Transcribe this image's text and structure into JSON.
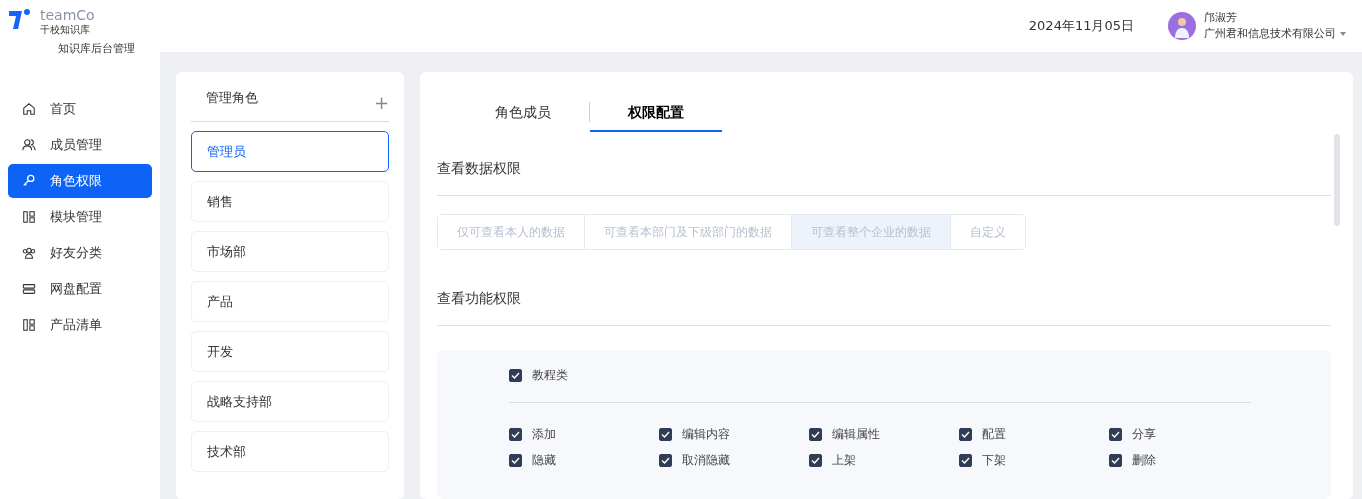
{
  "brand": {
    "name": "teamCo",
    "subtitle": "千校知识库",
    "app_title": "知识库后台管理"
  },
  "header": {
    "date": "2024年11月05日",
    "user_name": "邝淑芳",
    "company": "广州君和信息技术有限公司"
  },
  "sidebar": {
    "items": [
      {
        "label": "首页",
        "kind": "home",
        "selected": false
      },
      {
        "label": "成员管理",
        "kind": "users",
        "selected": false
      },
      {
        "label": "角色权限",
        "kind": "key",
        "selected": true
      },
      {
        "label": "模块管理",
        "kind": "layout",
        "selected": false
      },
      {
        "label": "好友分类",
        "kind": "group",
        "selected": false
      },
      {
        "label": "网盘配置",
        "kind": "storage",
        "selected": false
      },
      {
        "label": "产品清单",
        "kind": "layout",
        "selected": false
      }
    ]
  },
  "roles": {
    "title": "管理角色",
    "add_icon": "+",
    "items": [
      {
        "label": "管理员",
        "selected": true
      },
      {
        "label": "销售",
        "selected": false
      },
      {
        "label": "市场部",
        "selected": false
      },
      {
        "label": "产品",
        "selected": false
      },
      {
        "label": "开发",
        "selected": false
      },
      {
        "label": "战略支持部",
        "selected": false
      },
      {
        "label": "技术部",
        "selected": false
      }
    ]
  },
  "tabs": [
    {
      "label": "角色成员",
      "selected": false
    },
    {
      "label": "权限配置",
      "selected": true
    }
  ],
  "data_permission": {
    "title": "查看数据权限",
    "disabled": true,
    "options": [
      {
        "label": "仅可查看本人的数据",
        "selected": false
      },
      {
        "label": "可查看本部门及下级部门的数据",
        "selected": false
      },
      {
        "label": "可查看整个企业的数据",
        "selected": true
      },
      {
        "label": "自定义",
        "selected": false
      }
    ]
  },
  "function_permission": {
    "title": "查看功能权限",
    "groups": [
      {
        "label": "教程类",
        "checked": true,
        "items": [
          {
            "label": "添加",
            "checked": true
          },
          {
            "label": "编辑内容",
            "checked": true
          },
          {
            "label": "编辑属性",
            "checked": true
          },
          {
            "label": "配置",
            "checked": true
          },
          {
            "label": "分享",
            "checked": true
          },
          {
            "label": "隐藏",
            "checked": true
          },
          {
            "label": "取消隐藏",
            "checked": true
          },
          {
            "label": "上架",
            "checked": true
          },
          {
            "label": "下架",
            "checked": true
          },
          {
            "label": "删除",
            "checked": true
          }
        ]
      }
    ]
  }
}
